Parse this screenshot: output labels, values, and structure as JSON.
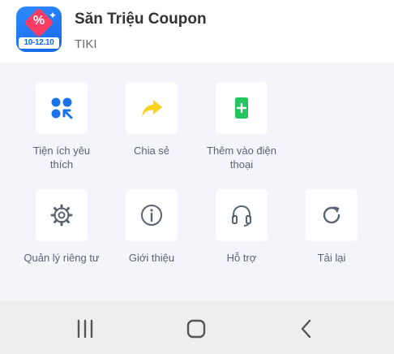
{
  "app": {
    "title": "Săn Triệu Coupon",
    "subtitle": "TIKI",
    "icon": "sale-coupon-app-icon",
    "icon_text": "%",
    "icon_date": "10-12.10"
  },
  "actions": [
    {
      "label": "Tiện ích yêu thích",
      "icon": "favorites-grid-icon",
      "color": "#1a73e8"
    },
    {
      "label": "Chia sẻ",
      "icon": "share-arrow-icon",
      "color": "#ffd21e"
    },
    {
      "label": "Thêm vào điện thoại",
      "icon": "add-to-phone-icon",
      "color": "#22c55e"
    },
    {
      "label": "Quản lý riêng tư",
      "icon": "settings-gear-icon",
      "color": "#5b6270"
    },
    {
      "label": "Giới thiệu",
      "icon": "info-icon",
      "color": "#5b6270"
    },
    {
      "label": "Hỗ trợ",
      "icon": "headset-icon",
      "color": "#5b6270"
    },
    {
      "label": "Tải lại",
      "icon": "reload-icon",
      "color": "#5b6270"
    }
  ],
  "navbar": {
    "recents": "recent-apps-icon",
    "home": "home-icon",
    "back": "back-icon"
  }
}
